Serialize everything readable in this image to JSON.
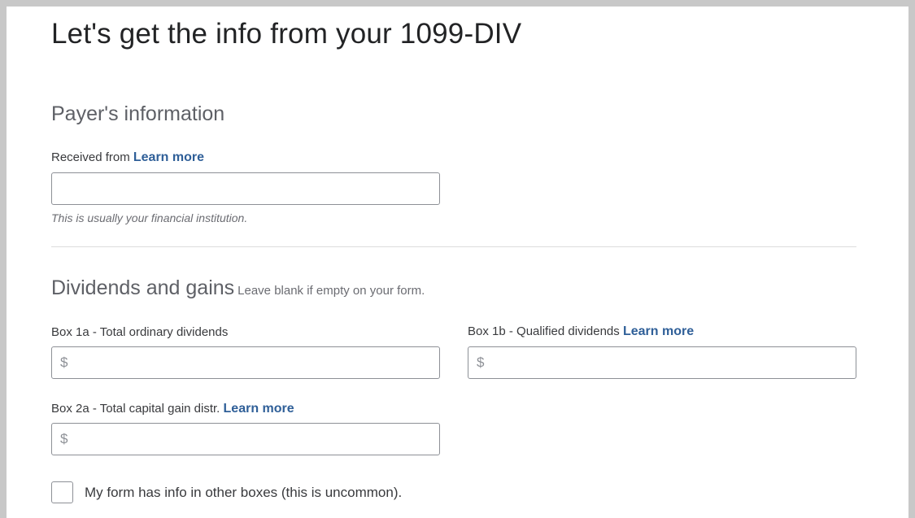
{
  "page": {
    "title": "Let's get the info from your 1099-DIV"
  },
  "payer": {
    "section_title": "Payer's information",
    "received_from_label": "Received from",
    "learn_more": "Learn more",
    "received_from_value": "",
    "helper_text": "This is usually your financial institution."
  },
  "dividends": {
    "section_title": "Dividends and gains",
    "section_note": "Leave blank if empty on your form.",
    "currency_symbol": "$",
    "box1a": {
      "label": "Box 1a - Total ordinary dividends",
      "value": ""
    },
    "box1b": {
      "label": "Box 1b - Qualified dividends",
      "learn_more": "Learn more",
      "value": ""
    },
    "box2a": {
      "label": "Box 2a - Total capital gain distr.",
      "learn_more": "Learn more",
      "value": ""
    }
  },
  "other_boxes": {
    "checkbox_label": "My form has info in other boxes (this is uncommon).",
    "checked": false
  },
  "colors": {
    "link": "#2f5f98",
    "border": "#8d9096",
    "text": "#393a3d",
    "frame": "#c8c8c8"
  }
}
